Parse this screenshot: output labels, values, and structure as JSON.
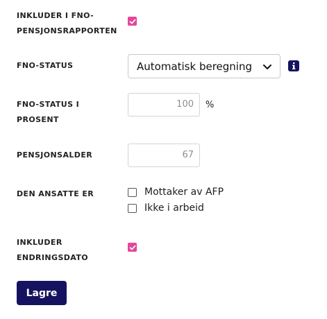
{
  "fields": {
    "include_report": {
      "label_line1": "INKLUDER I FNO-",
      "label_line2": "PENSJONSRAPPORTEN",
      "checked": true
    },
    "fno_status": {
      "label": "FNO-STATUS",
      "selected": "Automatisk beregning"
    },
    "fno_status_percent": {
      "label_line1": "FNO-STATUS I",
      "label_line2": "PROSENT",
      "value": "100",
      "suffix": "%"
    },
    "pension_age": {
      "label": "PENSJONSALDER",
      "value": "67"
    },
    "employee_is": {
      "label": "DEN ANSATTE ER",
      "options": [
        {
          "label": "Mottaker av AFP",
          "checked": false
        },
        {
          "label": "Ikke i arbeid",
          "checked": false
        }
      ]
    },
    "include_change_date": {
      "label_line1": "INKLUDER",
      "label_line2": "ENDRINGSDATO",
      "checked": true
    }
  },
  "actions": {
    "save_label": "Lagre"
  },
  "colors": {
    "accent": "#e2479a",
    "primary": "#15135f"
  },
  "icons": {
    "info": "info-icon",
    "select_arrow": "chevron-down-icon",
    "check": "check-icon"
  }
}
